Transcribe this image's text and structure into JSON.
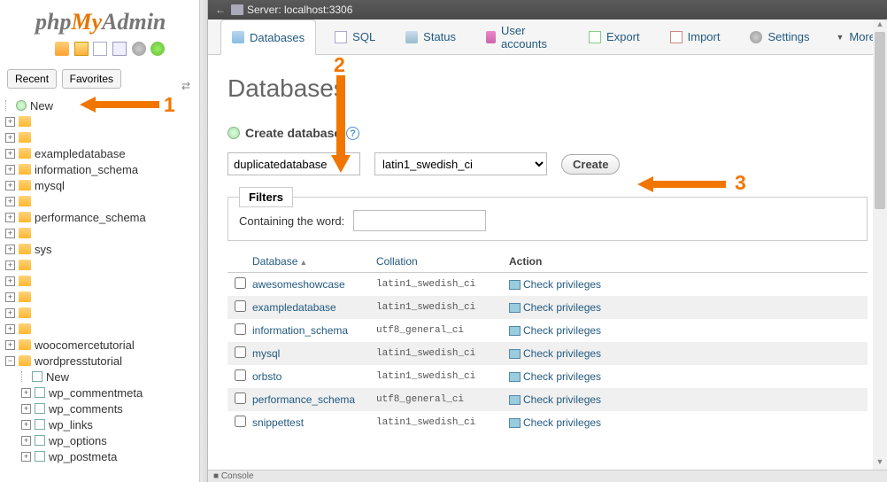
{
  "logo": {
    "php": "php",
    "my": "My",
    "admin": "Admin"
  },
  "sidebar_tabs": {
    "recent": "Recent",
    "favorites": "Favorites"
  },
  "tree": {
    "new": "New",
    "items": [
      "exampledatabase",
      "information_schema",
      "mysql",
      "performance_schema",
      "sys",
      "woocomercetutorial",
      "wordpresstutorial"
    ],
    "subnew": "New",
    "subtables": [
      "wp_commentmeta",
      "wp_comments",
      "wp_links",
      "wp_options",
      "wp_postmeta"
    ]
  },
  "server_label": "Server: localhost:3306",
  "nav": {
    "databases": "Databases",
    "sql": "SQL",
    "status": "Status",
    "users": "User accounts",
    "export": "Export",
    "import": "Import",
    "settings": "Settings",
    "more": "More"
  },
  "page_title": "Databases",
  "create": {
    "heading": "Create database",
    "input_value": "duplicatedatabase",
    "collation": "latin1_swedish_ci",
    "button": "Create"
  },
  "filters": {
    "legend": "Filters",
    "label": "Containing the word:",
    "value": ""
  },
  "table": {
    "hdr_db": "Database",
    "hdr_coll": "Collation",
    "hdr_action": "Action",
    "check_priv": "Check privileges",
    "rows": [
      {
        "db": "awesomeshowcase",
        "coll": "latin1_swedish_ci"
      },
      {
        "db": "exampledatabase",
        "coll": "latin1_swedish_ci"
      },
      {
        "db": "information_schema",
        "coll": "utf8_general_ci"
      },
      {
        "db": "mysql",
        "coll": "latin1_swedish_ci"
      },
      {
        "db": "orbsto",
        "coll": "latin1_swedish_ci"
      },
      {
        "db": "performance_schema",
        "coll": "utf8_general_ci"
      },
      {
        "db": "snippettest",
        "coll": "latin1_swedish_ci"
      }
    ]
  },
  "console": "Console",
  "annot": {
    "n1": "1",
    "n2": "2",
    "n3": "3"
  }
}
